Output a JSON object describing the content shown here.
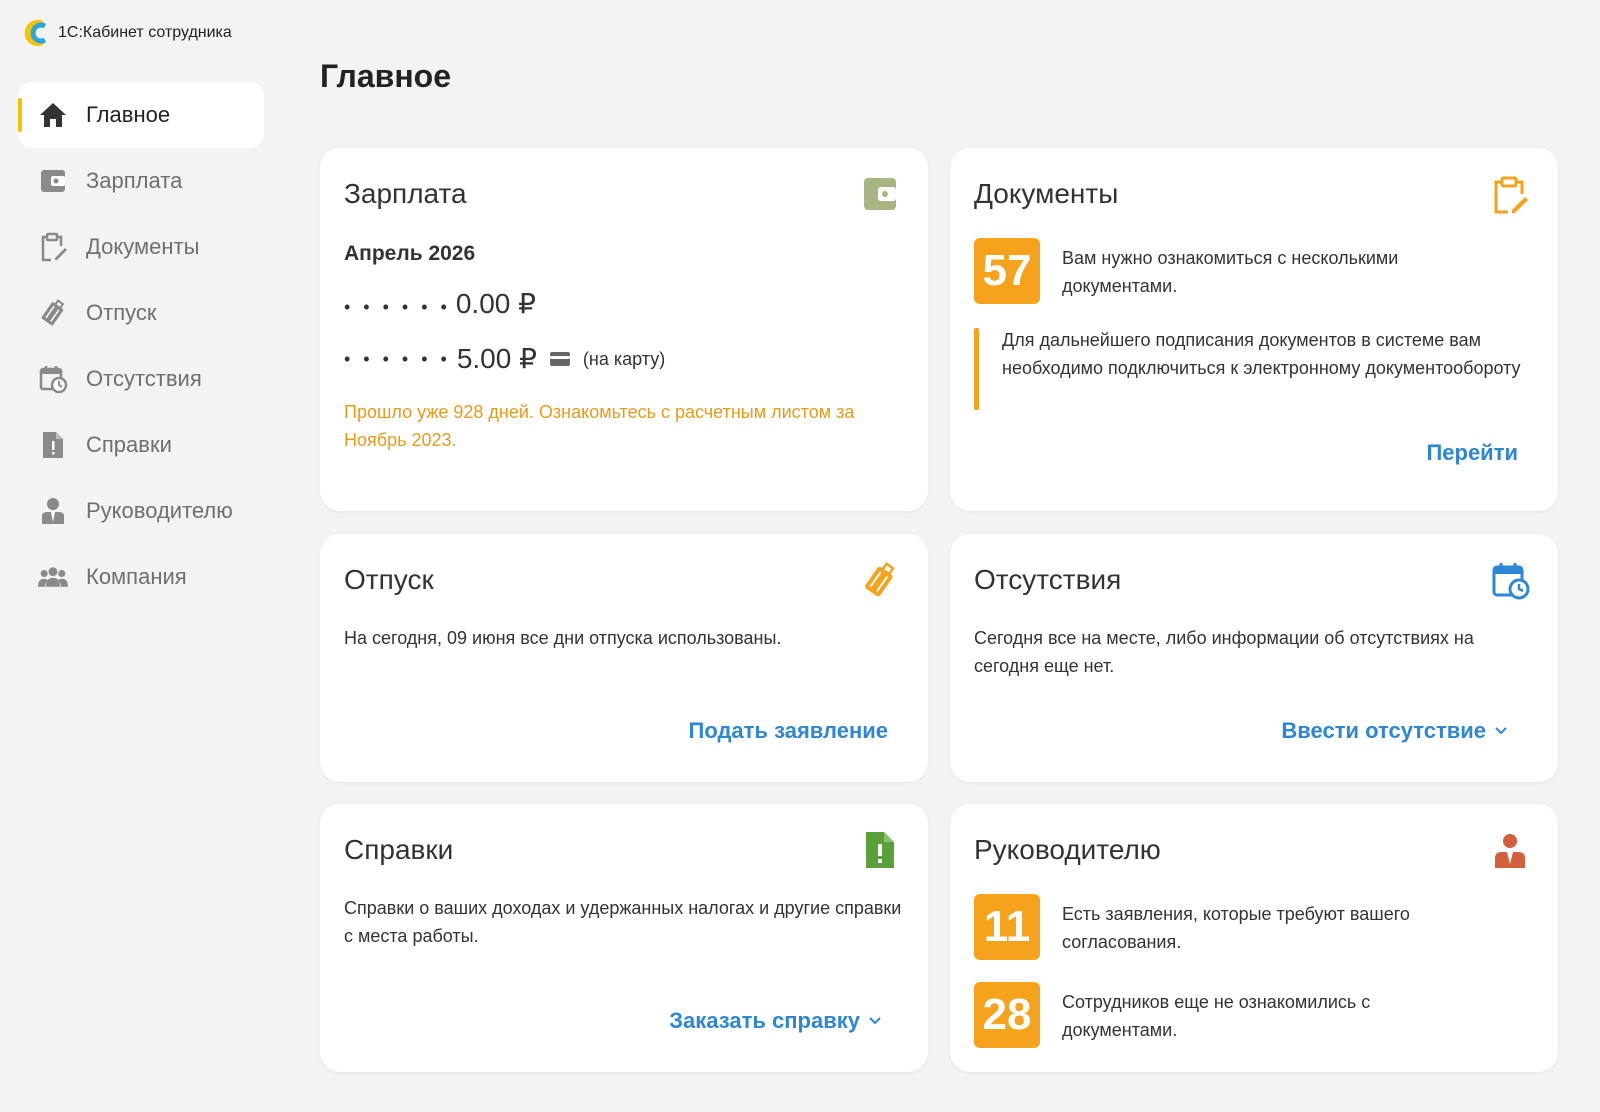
{
  "app": {
    "title": "1С:Кабинет сотрудника"
  },
  "sidebar": {
    "items": [
      {
        "label": "Главное",
        "icon": "home-icon",
        "active": true
      },
      {
        "label": "Зарплата",
        "icon": "wallet-icon"
      },
      {
        "label": "Документы",
        "icon": "clipboard-edit-icon"
      },
      {
        "label": "Отпуск",
        "icon": "luggage-icon"
      },
      {
        "label": "Отсутствия",
        "icon": "calendar-clock-icon"
      },
      {
        "label": "Справки",
        "icon": "document-alert-icon"
      },
      {
        "label": "Руководителю",
        "icon": "manager-icon"
      },
      {
        "label": "Компания",
        "icon": "people-icon"
      }
    ]
  },
  "page": {
    "title": "Главное"
  },
  "salary": {
    "title": "Зарплата",
    "period": "Апрель 2026",
    "line1_mask": "• • •  • • •",
    "line1_amount": "0.00 ₽",
    "line2_mask": "• • •  • • •",
    "line2_amount": "5.00 ₽",
    "line2_note": "(на карту)",
    "warning": "Прошло уже 928 дней. Ознакомьтесь с расчетным листом за Ноябрь 2023."
  },
  "documents": {
    "title": "Документы",
    "count": "57",
    "count_text": "Вам нужно ознакомиться с несколькими документами.",
    "notice": "Для дальнейшего подписания документов в системе вам необходимо подключиться к электронному документообороту",
    "link": "Перейти"
  },
  "vacation": {
    "title": "Отпуск",
    "text": "На сегодня, 09 июня все дни отпуска использованы.",
    "link": "Подать заявление"
  },
  "absences": {
    "title": "Отсутствия",
    "text": "Сегодня все на месте, либо информации об отсутствиях на сегодня еще нет.",
    "link": "Ввести отсутствие"
  },
  "certificates": {
    "title": "Справки",
    "text": "Справки о ваших доходах и удержанных налогах и другие справки с места работы.",
    "link": "Заказать справку"
  },
  "manager": {
    "title": "Руководителю",
    "count1": "11",
    "text1": "Есть заявления, которые требуют вашего согласования.",
    "count2": "28",
    "text2": "Сотрудников еще не ознакомились с документами."
  },
  "colors": {
    "accent_blue": "#2e86d9",
    "badge_orange": "#f5a21c",
    "warning_orange": "#e89a1a",
    "active_marker": "#f5c300"
  }
}
